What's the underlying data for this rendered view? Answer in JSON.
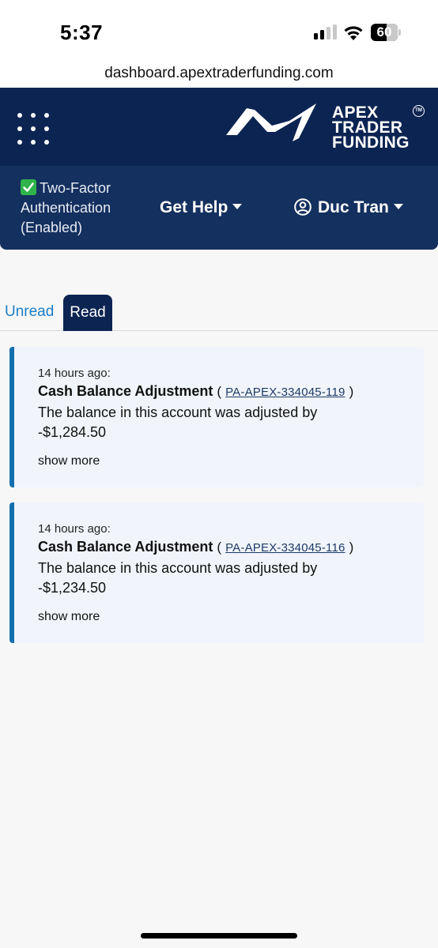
{
  "status_bar": {
    "time": "5:37",
    "battery": 60
  },
  "url_bar": {
    "url": "dashboard.apextraderfunding.com"
  },
  "header": {
    "logo_lines": [
      "APEX",
      "TRADER",
      "FUNDING"
    ],
    "tm": "TM",
    "logo_icon": "apex-swoosh-icon",
    "menu_icon": "grid-menu-icon"
  },
  "sub_nav": {
    "twofa_label": "Two-Factor Authentication (Enabled)",
    "help_label": "Get Help",
    "user_name": "Duc Tran"
  },
  "tabs": [
    {
      "label": "Unread",
      "active": false
    },
    {
      "label": "Read",
      "active": true
    }
  ],
  "notifications": [
    {
      "time": "14 hours ago:",
      "title": "Cash Balance Adjustment",
      "account": "PA-APEX-334045-119",
      "body": "The balance in this account was adjusted by -$1,284.50",
      "more": "show more"
    },
    {
      "time": "14 hours ago:",
      "title": "Cash Balance Adjustment",
      "account": "PA-APEX-334045-116",
      "body": "The balance in this account was adjusted by -$1,234.50",
      "more": "show more"
    }
  ],
  "colors": {
    "header_bg": "#0c2452",
    "subnav_bg": "#14305f",
    "tab_unread": "#1a7fc8",
    "card_bg": "#f1f5fb",
    "card_accent": "#1470ad",
    "check": "#2fb34a"
  }
}
